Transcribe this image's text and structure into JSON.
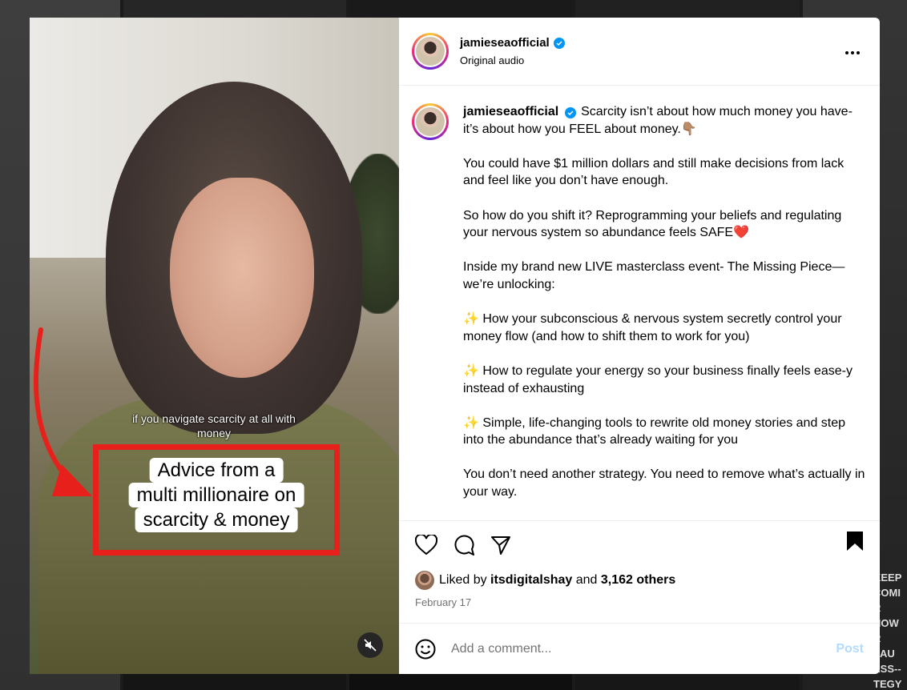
{
  "post": {
    "username": "jamieseaofficial",
    "audio": "Original audio",
    "caption": [
      "Scarcity isn’t about how much money you have- it’s about how you FEEL about money.👇🏽",
      "You could have $1 million dollars and still make decisions from lack and feel like you don’t have enough.",
      "So how do you shift it? Reprogramming your beliefs and regulating your nervous system so abundance feels SAFE❤️",
      "Inside my brand new LIVE masterclass event- The Missing Piece—we’re unlocking:",
      "✨ How your subconscious & nervous system secretly control your money flow (and how to shift them to work for you)",
      "✨ How to regulate your energy so your business finally feels ease-y instead of exhausting",
      "✨ Simple, life-changing tools to rewrite old money stories and step into the abundance that’s already waiting for you",
      "You don’t need another strategy. You need to remove what’s actually in your way."
    ],
    "likes": {
      "prefix": "Liked by",
      "user": "itsdigitalshay",
      "and": "and",
      "count": "3,162 others"
    },
    "date": "February 17"
  },
  "video": {
    "subtitle": "if you navigate scarcity at all with money",
    "overlay_lines": [
      "Advice from a",
      "multi millionaire on",
      "scarcity & money"
    ]
  },
  "comment": {
    "placeholder": "Add a comment...",
    "post_label": "Post"
  },
  "background_side_text": "KEEP COMI R HOW R LAU ESS-- TEGY",
  "icons": {
    "more": "more-options-icon",
    "like": "heart-icon",
    "comment": "comment-icon",
    "share": "share-icon",
    "save": "bookmark-icon",
    "emoji": "emoji-icon",
    "mute": "mute-icon",
    "verified": "verified-badge-icon"
  },
  "colors": {
    "verified": "#0095f6",
    "highlight_box": "#e8201b",
    "post_button": "#b3dbff"
  }
}
